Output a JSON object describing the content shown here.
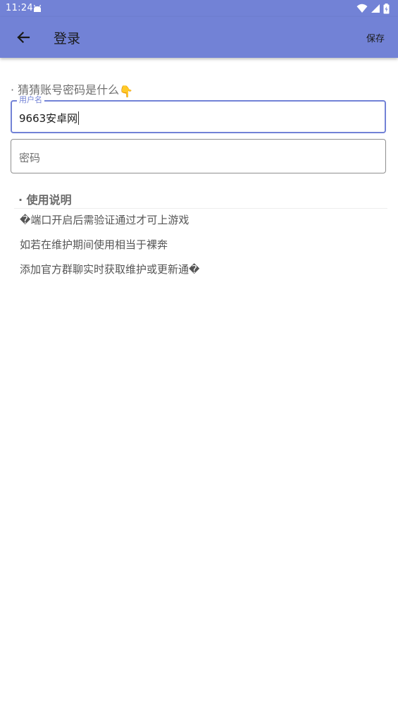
{
  "status_bar": {
    "time": "11:24",
    "app_icon": "android-icon",
    "icons": [
      "wifi-icon",
      "signal-icon",
      "battery-icon"
    ]
  },
  "app_bar": {
    "title": "登录",
    "save_label": "保存",
    "back_icon": "arrow-left-icon"
  },
  "form": {
    "hint": "· 猜猜账号密码是什么",
    "hint_emoji": "👇",
    "username": {
      "label": "用户名",
      "value": "9663安卓网"
    },
    "password": {
      "placeholder": "密码"
    }
  },
  "instructions": {
    "title": "· 使用说明",
    "items": [
      "�端口开启后需验证通过才可上游戏",
      "如若在维护期间使用相当于裸奔",
      "添加官方群聊实时获取维护或更新通�"
    ]
  },
  "colors": {
    "primary": "#7282d6",
    "text": "#1a1a1a",
    "muted": "#6f6f6f"
  }
}
